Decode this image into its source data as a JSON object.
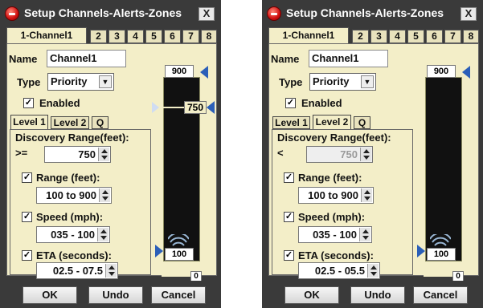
{
  "dialogs": [
    {
      "title": "Setup Channels-Alerts-Zones",
      "close": "X",
      "tabs": [
        "1-Channel1",
        "2",
        "3",
        "4",
        "5",
        "6",
        "7",
        "8"
      ],
      "name_label": "Name",
      "name_value": "Channel1",
      "type_label": "Type",
      "type_value": "Priority",
      "enabled_label": "Enabled",
      "level_tabs": [
        "Level 1",
        "Level 2",
        "Q"
      ],
      "active_level": "Level 1",
      "discovery_label": "Discovery Range(feet):",
      "discovery_op": ">=",
      "discovery_value": "750",
      "range_label": "Range (feet):",
      "range_value": "100 to 900",
      "speed_label": "Speed (mph):",
      "speed_value": "035 - 100",
      "eta_label": "ETA (seconds):",
      "eta_value": "02.5 - 07.5",
      "scale_max": "900",
      "scale_mark": "750",
      "scale_min": "100",
      "scale_zero": "0",
      "buttons": {
        "ok": "OK",
        "undo": "Undo",
        "cancel": "Cancel"
      }
    },
    {
      "title": "Setup Channels-Alerts-Zones",
      "close": "X",
      "tabs": [
        "1-Channel1",
        "2",
        "3",
        "4",
        "5",
        "6",
        "7",
        "8"
      ],
      "name_label": "Name",
      "name_value": "Channel1",
      "type_label": "Type",
      "type_value": "Priority",
      "enabled_label": "Enabled",
      "level_tabs": [
        "Level 1",
        "Level 2",
        "Q"
      ],
      "active_level": "Level 2",
      "discovery_label": "Discovery Range(feet):",
      "discovery_op": "<",
      "discovery_value": "750",
      "range_label": "Range (feet):",
      "range_value": "100 to 900",
      "speed_label": "Speed (mph):",
      "speed_value": "035 - 100",
      "eta_label": "ETA (seconds):",
      "eta_value": "02.5 - 05.5",
      "scale_max": "900",
      "scale_min": "100",
      "scale_zero": "0",
      "buttons": {
        "ok": "OK",
        "undo": "Undo",
        "cancel": "Cancel"
      }
    }
  ],
  "colors": {
    "panel": "#f3eec8",
    "chrome": "#3a3a3a",
    "marker": "#2b5fb8"
  }
}
